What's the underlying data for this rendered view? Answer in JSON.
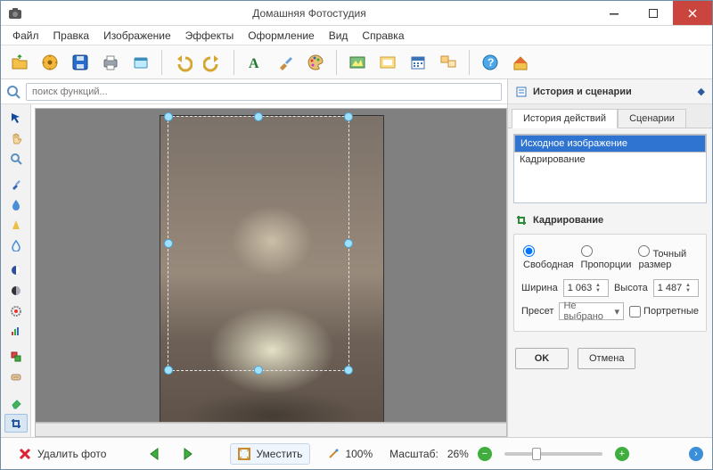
{
  "window": {
    "title": "Домашняя Фотостудия"
  },
  "menu": [
    "Файл",
    "Правка",
    "Изображение",
    "Эффекты",
    "Оформление",
    "Вид",
    "Справка"
  ],
  "search": {
    "placeholder": "поиск функций..."
  },
  "right": {
    "header": "История и сценарии",
    "tabs": {
      "history": "История действий",
      "scenarios": "Сценарии"
    },
    "history_items": [
      "Исходное изображение",
      "Кадрирование"
    ],
    "crop": {
      "title": "Кадрирование",
      "modes": {
        "free": "Свободная",
        "prop": "Пропорции",
        "exact": "Точный размер"
      },
      "width_label": "Ширина",
      "width_value": "1 063",
      "height_label": "Высота",
      "height_value": "1 487",
      "preset_label": "Пресет",
      "preset_value": "Не выбрано",
      "portrait": "Портретные",
      "ok": "OK",
      "cancel": "Отмена"
    }
  },
  "status": {
    "delete": "Удалить фото",
    "fit": "Уместить",
    "zoom100": "100%",
    "scale_label": "Масштаб:",
    "scale_value": "26%"
  },
  "colors": {
    "accent": "#2f74d0",
    "close": "#c9453d"
  }
}
